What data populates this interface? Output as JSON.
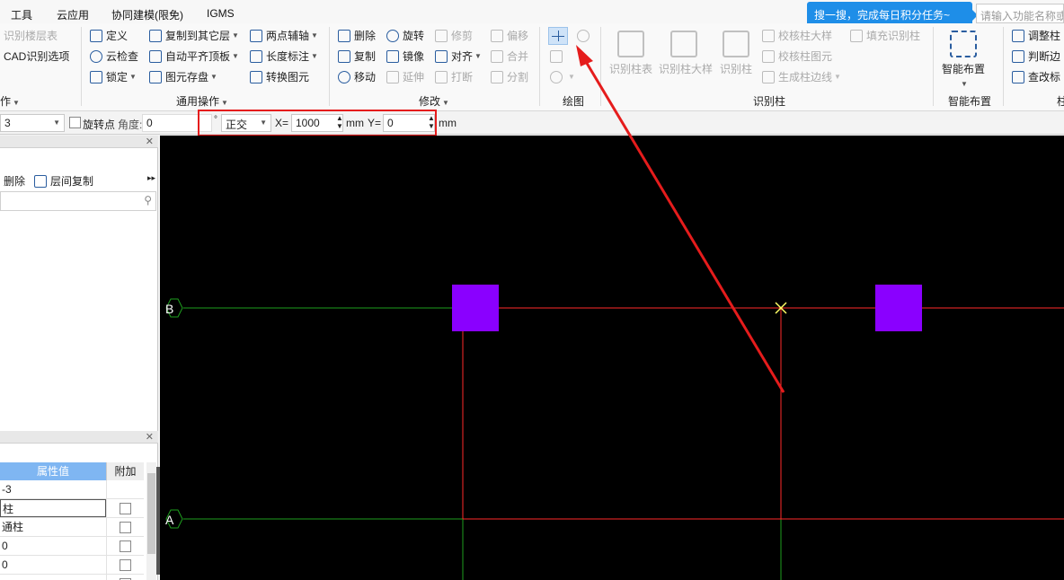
{
  "menubar": {
    "items": [
      "工具",
      "云应用",
      "协同建模(限免)",
      "IGMS"
    ],
    "promo": "搜一搜，完成每日积分任务~",
    "search_placeholder": "请输入功能名称或"
  },
  "ribbon": {
    "g1": {
      "items": [
        "识别楼层表",
        "CAD识别选项"
      ],
      "label": "作"
    },
    "g2": {
      "col1": [
        "定义",
        "云检查",
        "锁定"
      ],
      "col2": [
        "复制到其它层",
        "自动平齐顶板",
        "图元存盘"
      ],
      "col3": [
        "两点辅轴",
        "长度标注",
        "转换图元"
      ],
      "label": "通用操作"
    },
    "g3": {
      "col1": [
        "删除",
        "复制",
        "移动"
      ],
      "col2": [
        "旋转",
        "镜像",
        "延伸"
      ],
      "col3": [
        "修剪",
        "对齐",
        "打断"
      ],
      "col4": [
        "偏移",
        "合并",
        "分割"
      ],
      "label": "修改"
    },
    "g4": {
      "label": "绘图"
    },
    "g5": {
      "big": [
        "识别柱表",
        "识别柱大样",
        "识别柱"
      ],
      "small": [
        "校核柱大样",
        "校核柱图元",
        "生成柱边线",
        "填充识别柱"
      ],
      "label": "识别柱"
    },
    "g6": {
      "big": "智能布置",
      "label": "智能布置"
    },
    "g7": {
      "items": [
        "调整柱",
        "判断边",
        "查改标"
      ],
      "label": "柱"
    }
  },
  "toolbar2": {
    "combo_value": "3",
    "rotate_label": "旋转点",
    "angle_label": "角度:",
    "angle_value": "0",
    "degree": "°",
    "mode": "正交",
    "x_label": "X=",
    "x_value": "1000",
    "mm1": "mm",
    "y_label": "Y=",
    "y_value": "0",
    "mm2": "mm"
  },
  "left_panel": {
    "delete_label": "删除",
    "copy_label": "层间复制"
  },
  "properties": {
    "header_value": "属性值",
    "header_add": "附加",
    "rows": [
      "-3",
      "柱",
      "通柱",
      "0",
      "0",
      ""
    ]
  },
  "canvas": {
    "axis_b": "B",
    "axis_a": "A",
    "colors": {
      "grid_green": "#1e9e1e",
      "red_line": "#ff2a2a",
      "column": "#8a00ff",
      "cursor": "#ffff66"
    }
  }
}
